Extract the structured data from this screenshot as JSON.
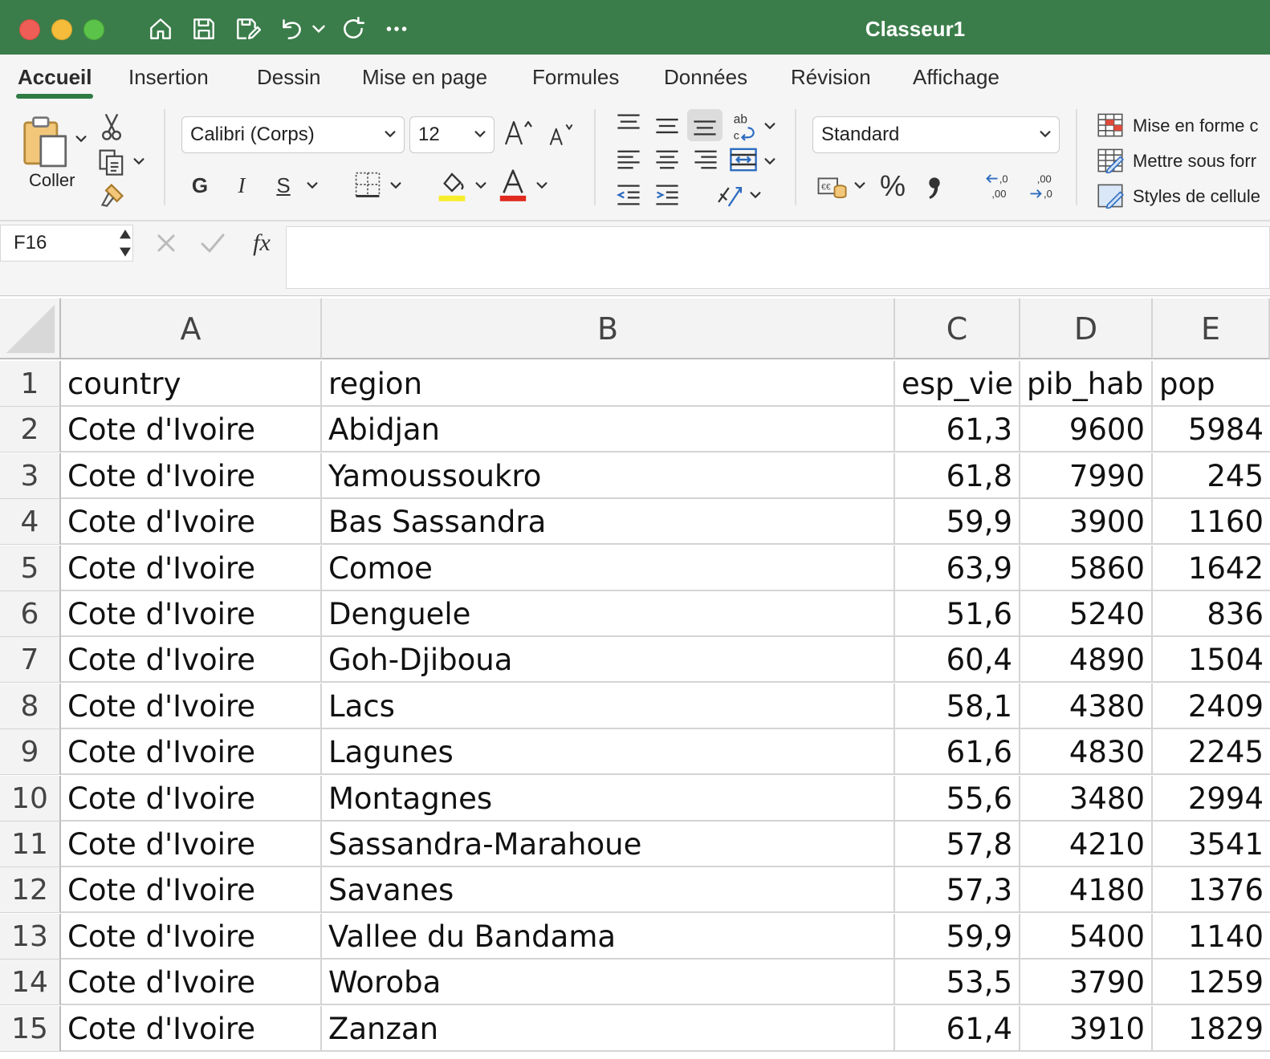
{
  "window": {
    "title": "Classeur1"
  },
  "tabs": [
    "Accueil",
    "Insertion",
    "Dessin",
    "Mise en page",
    "Formules",
    "Données",
    "Révision",
    "Affichage"
  ],
  "ribbon": {
    "paste_label": "Coller",
    "font_name": "Calibri (Corps)",
    "font_size": "12",
    "bold_glyph": "G",
    "italic_glyph": "I",
    "underline_glyph": "S",
    "number_format": "Standard",
    "percent_glyph": "%",
    "styles": {
      "conditional": "Mise en forme c",
      "as_table": "Mettre sous forr",
      "cell_styles": "Styles de cellule"
    }
  },
  "formula_bar": {
    "name_box": "F16",
    "fx": "fx",
    "value": ""
  },
  "sheet": {
    "columns": [
      "A",
      "B",
      "C",
      "D",
      "E"
    ],
    "row_numbers": [
      "1",
      "2",
      "3",
      "4",
      "5",
      "6",
      "7",
      "8",
      "9",
      "10",
      "11",
      "12",
      "13",
      "14",
      "15"
    ],
    "rows": [
      [
        "country",
        "region",
        "esp_vie",
        "pib_hab",
        "pop"
      ],
      [
        "Cote d'Ivoire",
        "Abidjan",
        "61,3",
        "9600",
        "5984"
      ],
      [
        "Cote d'Ivoire",
        "Yamoussoukro",
        "61,8",
        "7990",
        "245"
      ],
      [
        "Cote d'Ivoire",
        "Bas Sassandra",
        "59,9",
        "3900",
        "1160"
      ],
      [
        "Cote d'Ivoire",
        "Comoe",
        "63,9",
        "5860",
        "1642"
      ],
      [
        "Cote d'Ivoire",
        "Denguele",
        "51,6",
        "5240",
        "836"
      ],
      [
        "Cote d'Ivoire",
        "Goh-Djiboua",
        "60,4",
        "4890",
        "1504"
      ],
      [
        "Cote d'Ivoire",
        "Lacs",
        "58,1",
        "4380",
        "2409"
      ],
      [
        "Cote d'Ivoire",
        "Lagunes",
        "61,6",
        "4830",
        "2245"
      ],
      [
        "Cote d'Ivoire",
        "Montagnes",
        "55,6",
        "3480",
        "2994"
      ],
      [
        "Cote d'Ivoire",
        "Sassandra-Marahoue",
        "57,8",
        "4210",
        "3541"
      ],
      [
        "Cote d'Ivoire",
        "Savanes",
        "57,3",
        "4180",
        "1376"
      ],
      [
        "Cote d'Ivoire",
        "Vallee du Bandama",
        "59,9",
        "5400",
        "1140"
      ],
      [
        "Cote d'Ivoire",
        "Woroba",
        "53,5",
        "3790",
        "1259"
      ],
      [
        "Cote d'Ivoire",
        "Zanzan",
        "61,4",
        "3910",
        "1829"
      ]
    ]
  },
  "colors": {
    "titlebar": "#3b7d4a",
    "close": "#ee5e56",
    "minimize": "#f5bb3a",
    "zoom": "#5cc34a"
  }
}
